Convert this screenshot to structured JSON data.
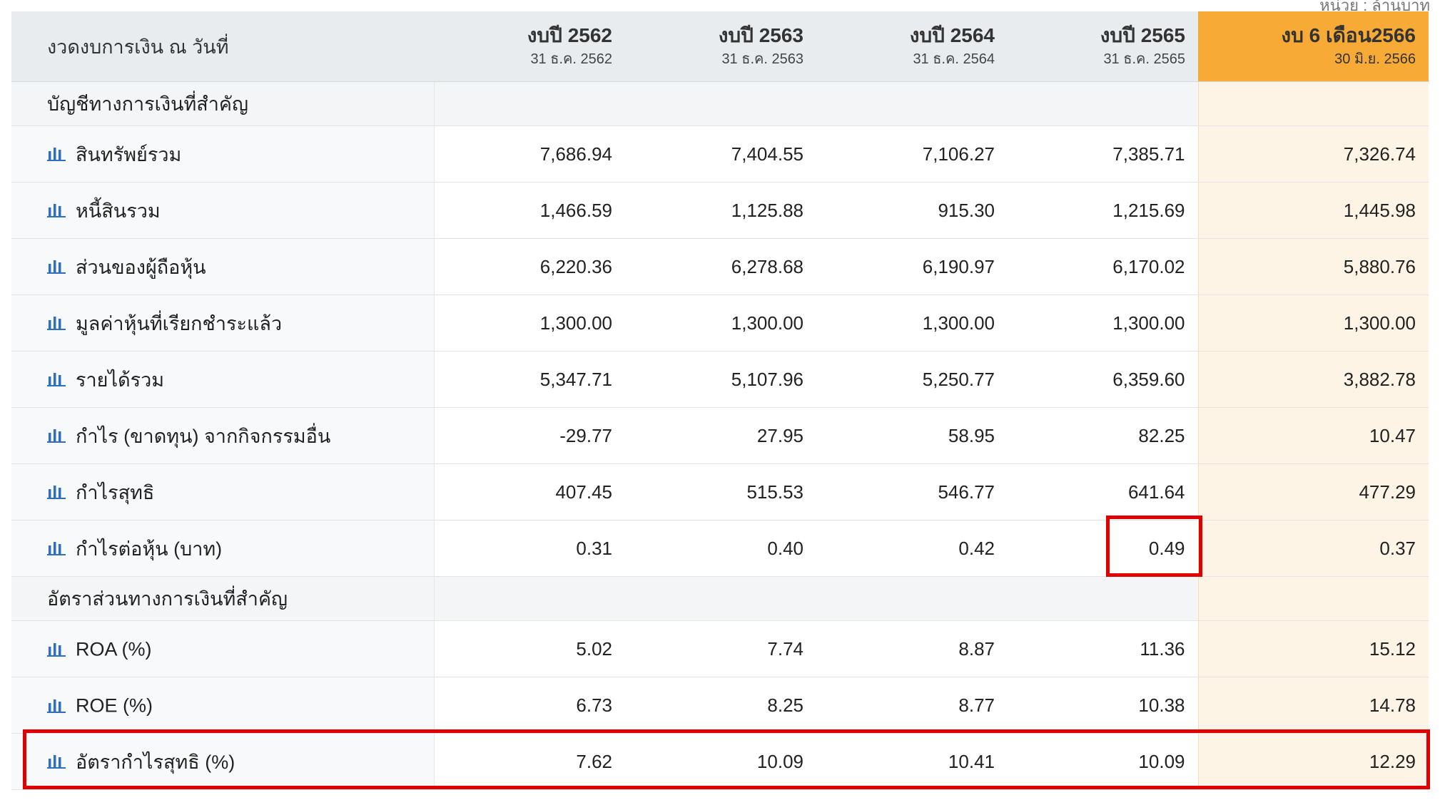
{
  "unit_note": "หน่วย : ล้านบาท",
  "header": {
    "label": "งวดงบการเงิน ณ วันที่",
    "columns": [
      {
        "title": "งบปี 2562",
        "date": "31 ธ.ค. 2562"
      },
      {
        "title": "งบปี 2563",
        "date": "31 ธ.ค. 2563"
      },
      {
        "title": "งบปี 2564",
        "date": "31 ธ.ค. 2564"
      },
      {
        "title": "งบปี 2565",
        "date": "31 ธ.ค. 2565"
      },
      {
        "title": "งบ 6 เดือน2566",
        "date": "30 มิ.ย. 2566"
      }
    ]
  },
  "sections": [
    {
      "title": "บัญชีทางการเงินที่สำคัญ",
      "rows": [
        {
          "label": "สินทรัพย์รวม",
          "values": [
            "7,686.94",
            "7,404.55",
            "7,106.27",
            "7,385.71",
            "7,326.74"
          ]
        },
        {
          "label": "หนี้สินรวม",
          "values": [
            "1,466.59",
            "1,125.88",
            "915.30",
            "1,215.69",
            "1,445.98"
          ]
        },
        {
          "label": "ส่วนของผู้ถือหุ้น",
          "values": [
            "6,220.36",
            "6,278.68",
            "6,190.97",
            "6,170.02",
            "5,880.76"
          ]
        },
        {
          "label": "มูลค่าหุ้นที่เรียกชำระแล้ว",
          "values": [
            "1,300.00",
            "1,300.00",
            "1,300.00",
            "1,300.00",
            "1,300.00"
          ]
        },
        {
          "label": "รายได้รวม",
          "values": [
            "5,347.71",
            "5,107.96",
            "5,250.77",
            "6,359.60",
            "3,882.78"
          ]
        },
        {
          "label": "กำไร (ขาดทุน) จากกิจกรรมอื่น",
          "values": [
            "-29.77",
            "27.95",
            "58.95",
            "82.25",
            "10.47"
          ]
        },
        {
          "label": "กำไรสุทธิ",
          "values": [
            "407.45",
            "515.53",
            "546.77",
            "641.64",
            "477.29"
          ]
        },
        {
          "label": "กำไรต่อหุ้น (บาท)",
          "values": [
            "0.31",
            "0.40",
            "0.42",
            "0.49",
            "0.37"
          ]
        }
      ]
    },
    {
      "title": "อัตราส่วนทางการเงินที่สำคัญ",
      "rows": [
        {
          "label": "ROA (%)",
          "values": [
            "5.02",
            "7.74",
            "8.87",
            "11.36",
            "15.12"
          ]
        },
        {
          "label": "ROE (%)",
          "values": [
            "6.73",
            "8.25",
            "8.77",
            "10.38",
            "14.78"
          ]
        },
        {
          "label": "อัตรากำไรสุทธิ (%)",
          "values": [
            "7.62",
            "10.09",
            "10.41",
            "10.09",
            "12.29"
          ]
        }
      ]
    }
  ],
  "colors": {
    "highlight_header": "#f7ab36",
    "highlight_column": "#fdf4e6",
    "chart_icon": "#2f6fc0",
    "annotation_box": "#e00000"
  },
  "icons": {
    "row_chart": "bar-chart-icon"
  }
}
